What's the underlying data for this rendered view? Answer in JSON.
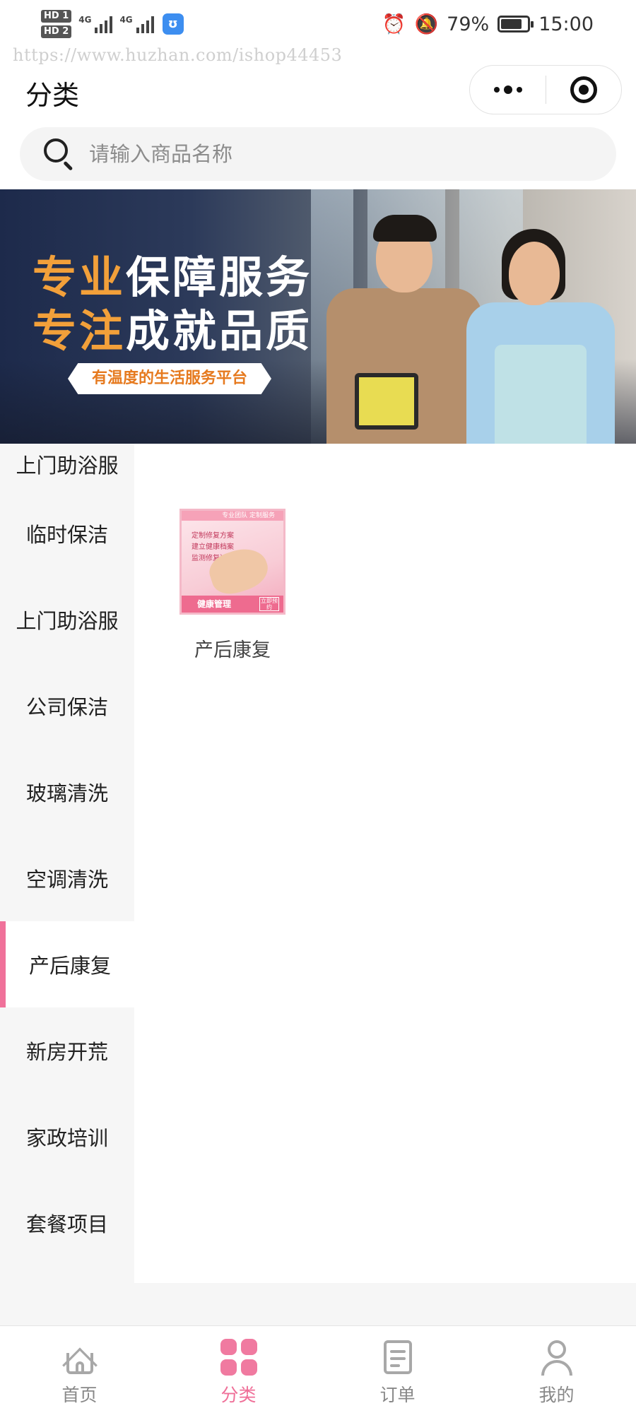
{
  "status_bar": {
    "sim_labels": [
      "HD 1",
      "HD 2"
    ],
    "network_labels": [
      "4G",
      "4G"
    ],
    "battery_percent": "79%",
    "battery_level": 0.79,
    "time": "15:00"
  },
  "watermark": "https://www.huzhan.com/ishop44453",
  "header": {
    "title": "分类"
  },
  "search": {
    "placeholder": "请输入商品名称"
  },
  "banner": {
    "line1_highlight": "专业",
    "line1_rest": "保障服务",
    "line2_highlight": "专注",
    "line2_rest": "成就品质",
    "tagline": "有温度的生活服务平台"
  },
  "categories": [
    {
      "label": "上门助浴服"
    },
    {
      "label": "临时保洁"
    },
    {
      "label": "上门助浴服"
    },
    {
      "label": "公司保洁"
    },
    {
      "label": "玻璃清洗"
    },
    {
      "label": "空调清洗"
    },
    {
      "label": "产后康复",
      "active": true
    },
    {
      "label": "新房开荒"
    },
    {
      "label": "家政培训"
    },
    {
      "label": "套餐项目"
    }
  ],
  "products": [
    {
      "name": "产后康复",
      "thumb_top": "专业团队 定制服务",
      "thumb_lines": [
        "定制修复方案",
        "建立健康档案",
        "监测修复过程"
      ],
      "thumb_footer": "健康管理",
      "thumb_badge": "立即预约"
    }
  ],
  "tabbar": [
    {
      "label": "首页",
      "icon": "home-icon"
    },
    {
      "label": "分类",
      "icon": "category-grid-icon",
      "active": true
    },
    {
      "label": "订单",
      "icon": "order-icon"
    },
    {
      "label": "我的",
      "icon": "user-icon"
    }
  ],
  "colors": {
    "accent": "#f0719a",
    "banner_highlight": "#f2a03a",
    "nav_background": "#f6f6f6"
  }
}
